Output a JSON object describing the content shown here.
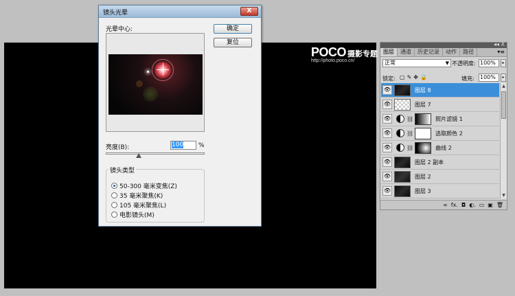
{
  "watermark": {
    "logo": "POCO",
    "name": "摄影专题",
    "url": "http://photo.poco.cn/"
  },
  "dialog": {
    "title": "镜头光晕",
    "close": "X",
    "flare_center_label": "光晕中心:",
    "ok": "确定",
    "reset": "复位",
    "brightness_label": "亮度(B):",
    "brightness_value": "100",
    "brightness_unit": "%",
    "brightness_level": 1.0,
    "lens_group_title": "镜头类型",
    "lens_types": [
      {
        "label": "50-300 毫米变焦(Z)",
        "selected": true
      },
      {
        "label": "35 毫米聚焦(K)",
        "selected": false
      },
      {
        "label": "105 毫米聚焦(L)",
        "selected": false
      },
      {
        "label": "电影镜头(M)",
        "selected": false
      }
    ]
  },
  "layers_panel": {
    "collapse": "◂◂ X",
    "tabs": [
      "图层",
      "通道",
      "历史记录",
      "动作",
      "路径"
    ],
    "menu": "▾≡",
    "blend_mode": "正常",
    "opacity_label": "不透明度:",
    "opacity": "100%",
    "lock_label": "锁定:",
    "lock_icons": [
      "▢",
      "✎",
      "✥",
      "🔒"
    ],
    "fill_label": "填充:",
    "fill": "100%",
    "eye": "👁",
    "layers": [
      {
        "name": "图层 8",
        "type": "dark",
        "selected": true
      },
      {
        "name": "图层 7",
        "type": "check",
        "selected": false
      },
      {
        "name": "照片滤镜 1",
        "type": "adjust",
        "mask": "grad",
        "selected": false
      },
      {
        "name": "选取颜色 2",
        "type": "adjust",
        "mask": "white",
        "selected": false
      },
      {
        "name": "曲线 2",
        "type": "adjust",
        "mask": "grad2",
        "selected": false
      },
      {
        "name": "图层 2 副本",
        "type": "dark",
        "selected": false
      },
      {
        "name": "图层 2",
        "type": "dark2",
        "selected": false
      },
      {
        "name": "图层 3",
        "type": "dark",
        "selected": false
      }
    ],
    "footer_icons": [
      "∞",
      "fx.",
      "◘",
      "◐.",
      "▭",
      "▣",
      "🗑"
    ]
  }
}
